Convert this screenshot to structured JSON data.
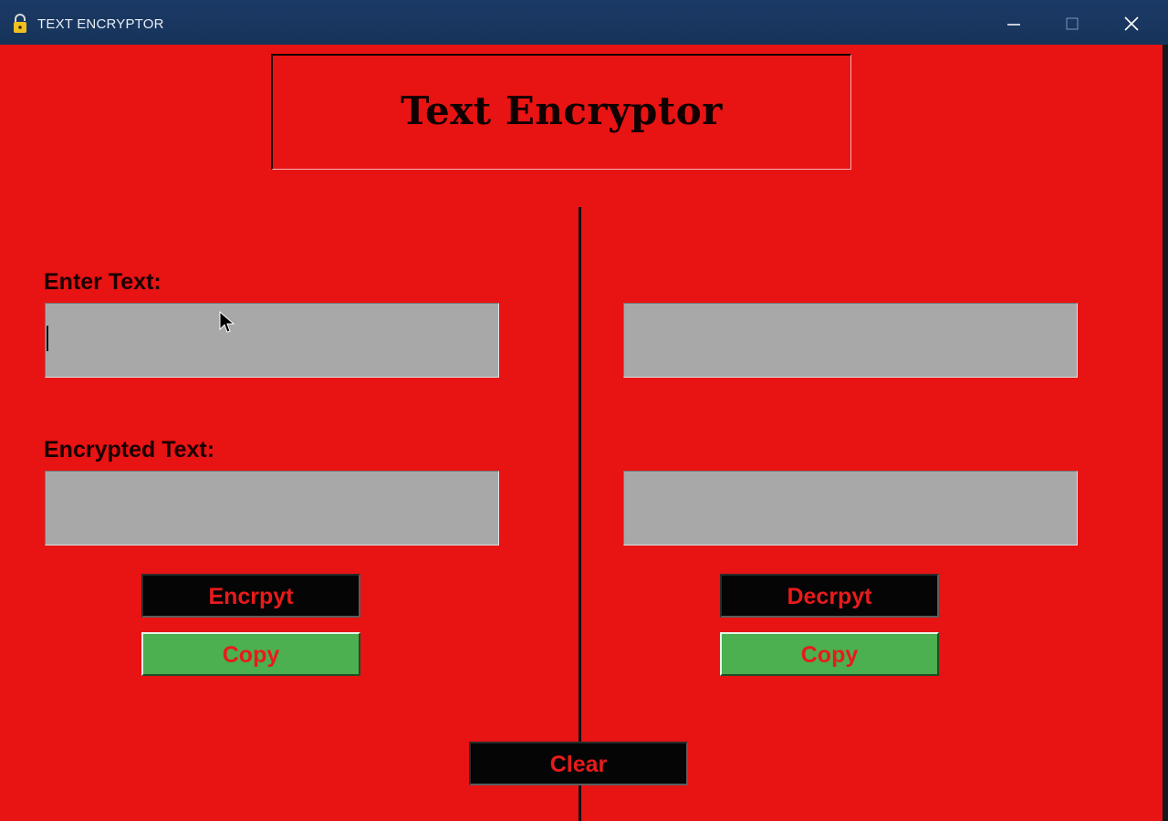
{
  "window": {
    "title": "TEXT ENCRYPTOR"
  },
  "heading": "Text Encryptor",
  "left": {
    "input_label": "Enter Text:",
    "input_value": "",
    "output_label": "Encrypted Text:",
    "output_value": "",
    "action_label": "Encrpyt",
    "copy_label": "Copy"
  },
  "right": {
    "input_value": "",
    "output_value": "",
    "action_label": "Decrpyt",
    "copy_label": "Copy"
  },
  "clear_label": "Clear",
  "colors": {
    "background": "#e81313",
    "field": "#a8a8a8",
    "button_dark": "#050505",
    "button_green": "#4caf50",
    "button_text": "#e81b1b",
    "titlebar": "#1b3a66"
  },
  "icons": {
    "app": "lock-icon",
    "minimize": "minimize-icon",
    "maximize": "maximize-icon",
    "close": "close-icon"
  }
}
